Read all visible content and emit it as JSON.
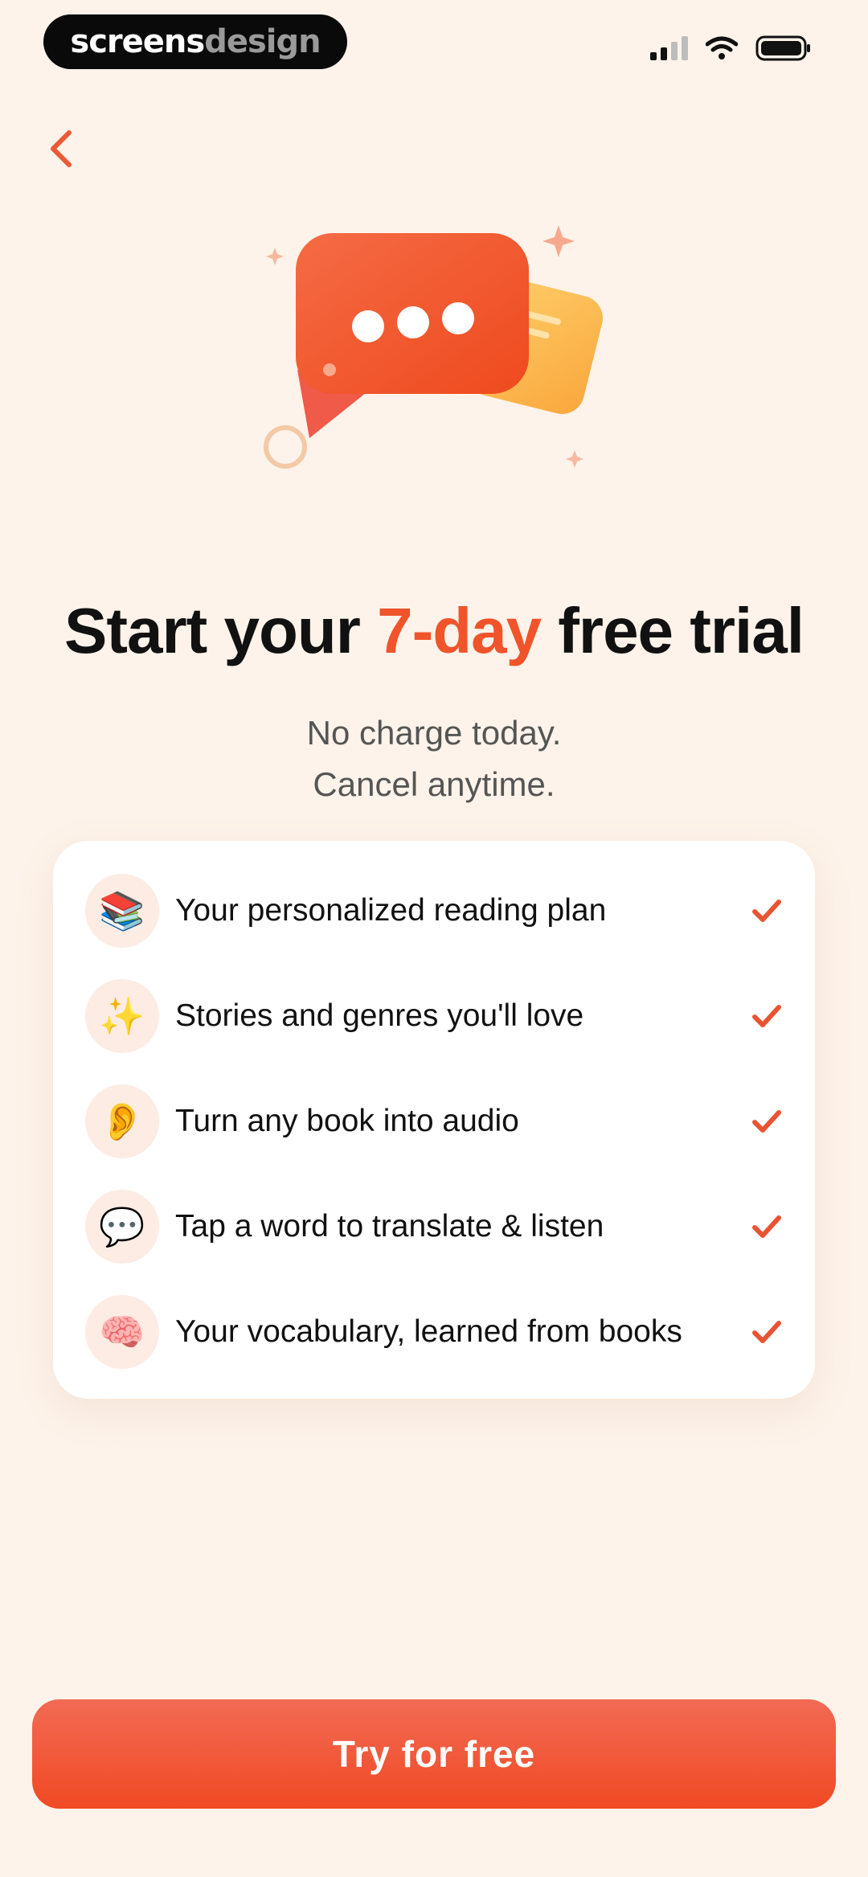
{
  "watermark": {
    "part1": "screens",
    "part2": "design"
  },
  "status_bar": {
    "icons": [
      "cellular-signal-icon",
      "wifi-icon",
      "battery-icon"
    ]
  },
  "header": {
    "back_icon": "chevron-left-icon"
  },
  "hero": {
    "title_prefix": "Start your ",
    "title_accent": "7-day",
    "title_suffix": " free trial",
    "subtitle_line1": "No charge today.",
    "subtitle_line2": "Cancel anytime."
  },
  "features": [
    {
      "icon": "📚",
      "icon_name": "books-icon",
      "label": "Your personalized reading plan"
    },
    {
      "icon": "✨",
      "icon_name": "sparkles-icon",
      "label": "Stories and genres you'll love"
    },
    {
      "icon": "👂",
      "icon_name": "ear-icon",
      "label": "Turn any book into audio"
    },
    {
      "icon": "💬",
      "icon_name": "speech-bubble-icon",
      "label": "Tap a word to translate & listen"
    },
    {
      "icon": "🧠",
      "icon_name": "brain-icon",
      "label": "Your vocabulary, learned from books"
    }
  ],
  "cta": {
    "label": "Try for free"
  },
  "colors": {
    "accent": "#f0542b",
    "background": "#fdf3ea",
    "card": "#ffffff"
  }
}
